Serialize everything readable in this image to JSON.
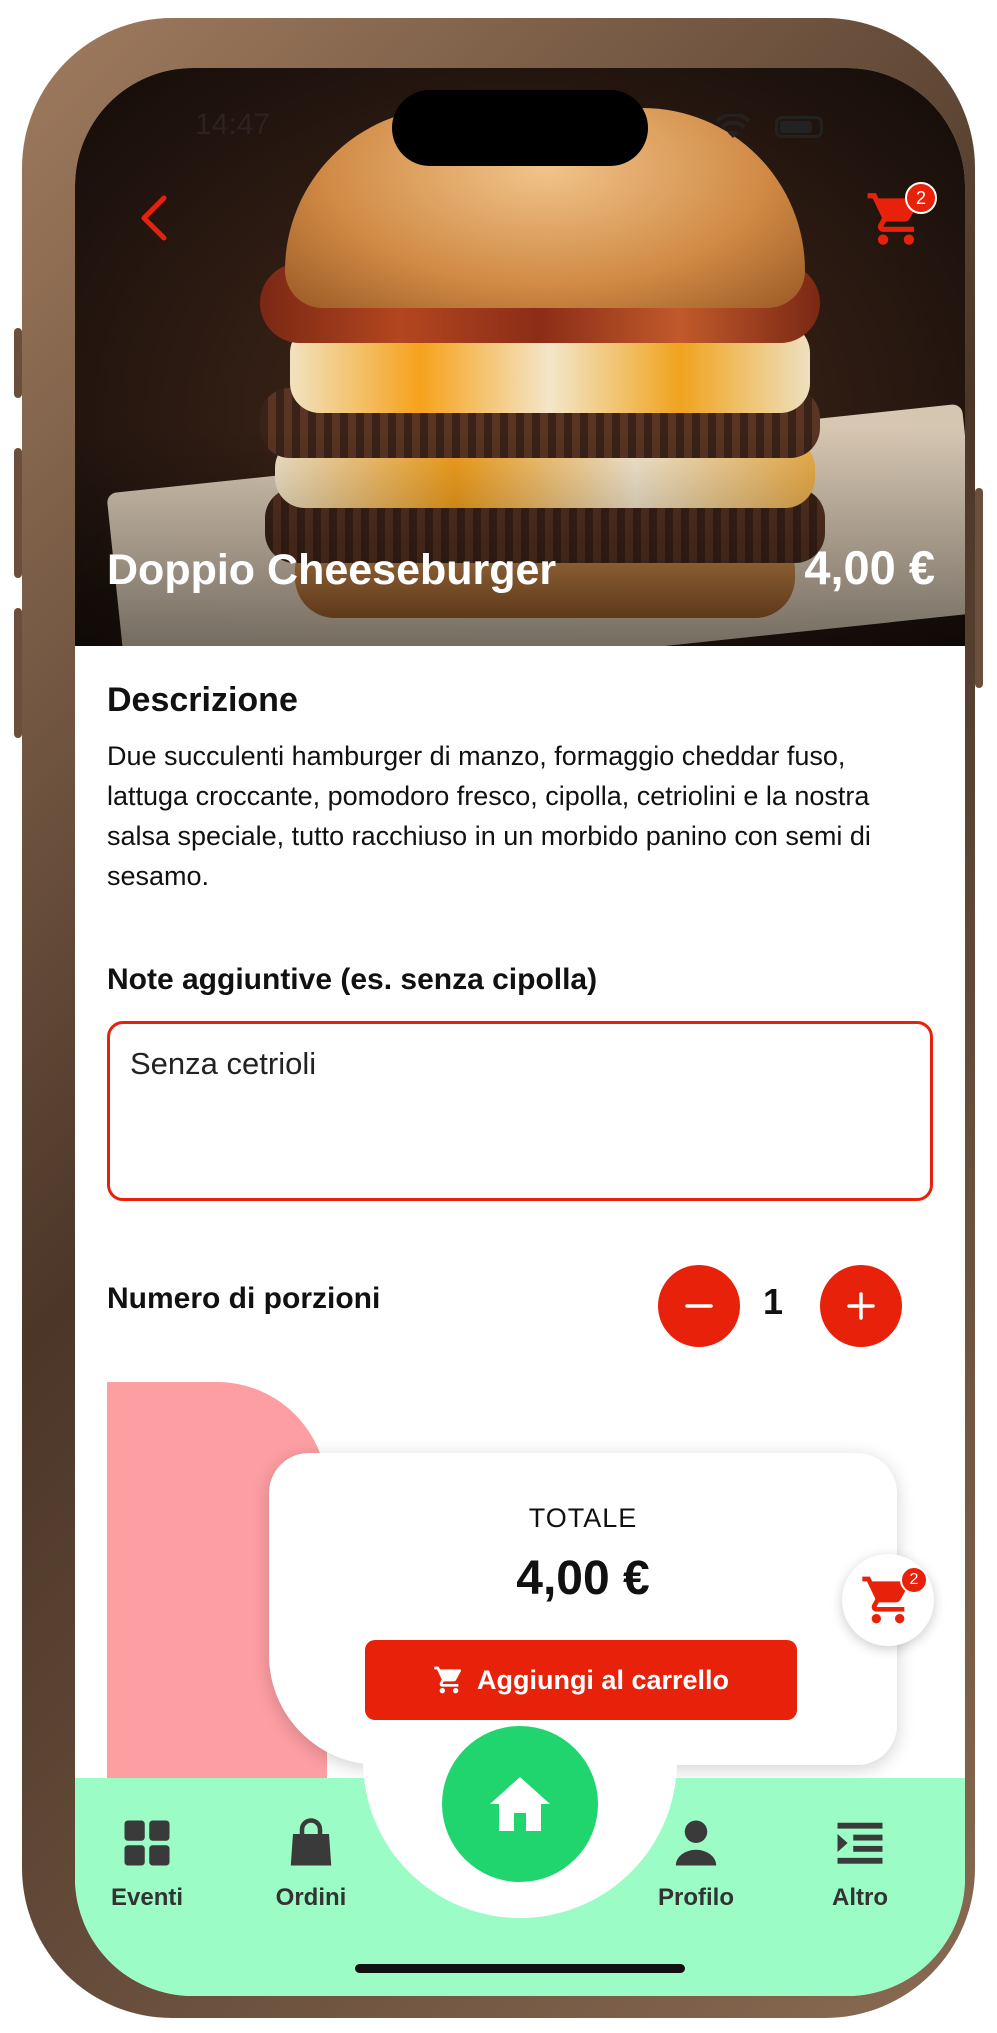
{
  "status_bar": {
    "time": "14:47"
  },
  "header": {
    "cart_badge": "2"
  },
  "product": {
    "title": "Doppio Cheeseburger",
    "price": "4,00 €"
  },
  "description": {
    "heading": "Descrizione",
    "text": "Due succulenti hamburger di manzo, formaggio cheddar fuso, lattuga croccante, pomodoro fresco, cipolla, cetriolini e la nostra salsa speciale, tutto racchiuso in un morbido panino con semi di sesamo."
  },
  "notes": {
    "label": "Note aggiuntive (es. senza cipolla)",
    "value": "Senza cetrioli"
  },
  "portions": {
    "label": "Numero di porzioni",
    "quantity": "1"
  },
  "total": {
    "label": "TOTALE",
    "value": "4,00 €",
    "add_button_label": "Aggiungi al carrello"
  },
  "floating_cart": {
    "badge": "2"
  },
  "bottom_nav": {
    "items": [
      {
        "label": "Eventi",
        "icon": "grid-icon"
      },
      {
        "label": "Ordini",
        "icon": "shopping-bag-icon"
      },
      {
        "label": "Home",
        "icon": "home-icon"
      },
      {
        "label": "Profilo",
        "icon": "user-icon"
      },
      {
        "label": "Altro",
        "icon": "menu-list-icon"
      }
    ]
  },
  "colors": {
    "accent": "#e8210a",
    "nav_background": "#9cfcc5",
    "home_button": "#20d46e",
    "decor_pink": "#fd9ea3"
  }
}
